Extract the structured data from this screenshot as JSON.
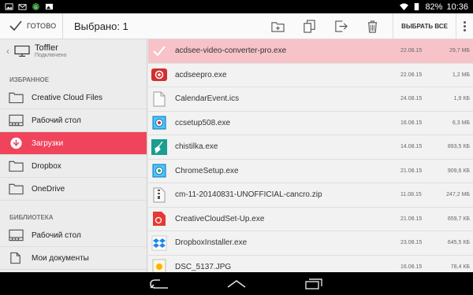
{
  "status": {
    "battery": "82%",
    "time": "10:36"
  },
  "actionbar": {
    "done_label": "ГОТОВО",
    "title": "Выбрано: 1",
    "select_all": "ВЫБРАТЬ ВСЕ"
  },
  "device": {
    "name": "Toffler",
    "status": "Подключено"
  },
  "sidebar": {
    "favorites_header": "ИЗБРАННОЕ",
    "favorites": [
      {
        "label": "Creative Cloud Files",
        "icon": "folder-icon"
      },
      {
        "label": "Рабочий стол",
        "icon": "desktop-icon"
      },
      {
        "label": "Загрузки",
        "icon": "download-icon"
      },
      {
        "label": "Dropbox",
        "icon": "folder-icon"
      },
      {
        "label": "OneDrive",
        "icon": "folder-icon"
      }
    ],
    "library_header": "БИБЛИОТЕКА",
    "library": [
      {
        "label": "Рабочий стол",
        "icon": "desktop-icon"
      },
      {
        "label": "Мои документы",
        "icon": "documents-icon"
      }
    ]
  },
  "files": [
    {
      "name": "acdsee-video-converter-pro.exe",
      "date": "22.08.15",
      "size": "29,7 МБ",
      "icon": "check-icon"
    },
    {
      "name": "acdseepro.exe",
      "date": "22.08.15",
      "size": "1,2 МБ",
      "icon": "acdsee-icon"
    },
    {
      "name": "CalendarEvent.ics",
      "date": "24.08.15",
      "size": "1,9 КБ",
      "icon": "file-icon"
    },
    {
      "name": "ccsetup508.exe",
      "date": "16.08.15",
      "size": "6,3 МБ",
      "icon": "installer-icon"
    },
    {
      "name": "chistilka.exe",
      "date": "14.08.15",
      "size": "893,5 КБ",
      "icon": "broom-icon"
    },
    {
      "name": "ChromeSetup.exe",
      "date": "21.08.15",
      "size": "909,6 КБ",
      "icon": "installer-icon"
    },
    {
      "name": "cm-11-20140831-UNOFFICIAL-cancro.zip",
      "date": "11.08.15",
      "size": "247,2 МБ",
      "icon": "zip-icon"
    },
    {
      "name": "CreativeCloudSet-Up.exe",
      "date": "21.08.15",
      "size": "659,7 КБ",
      "icon": "creative-cloud-icon"
    },
    {
      "name": "DropboxInstaller.exe",
      "date": "23.08.15",
      "size": "645,5 КБ",
      "icon": "dropbox-icon"
    },
    {
      "name": "DSC_5137.JPG",
      "date": "16.08.15",
      "size": "78,4 КБ",
      "icon": "image-icon"
    }
  ]
}
